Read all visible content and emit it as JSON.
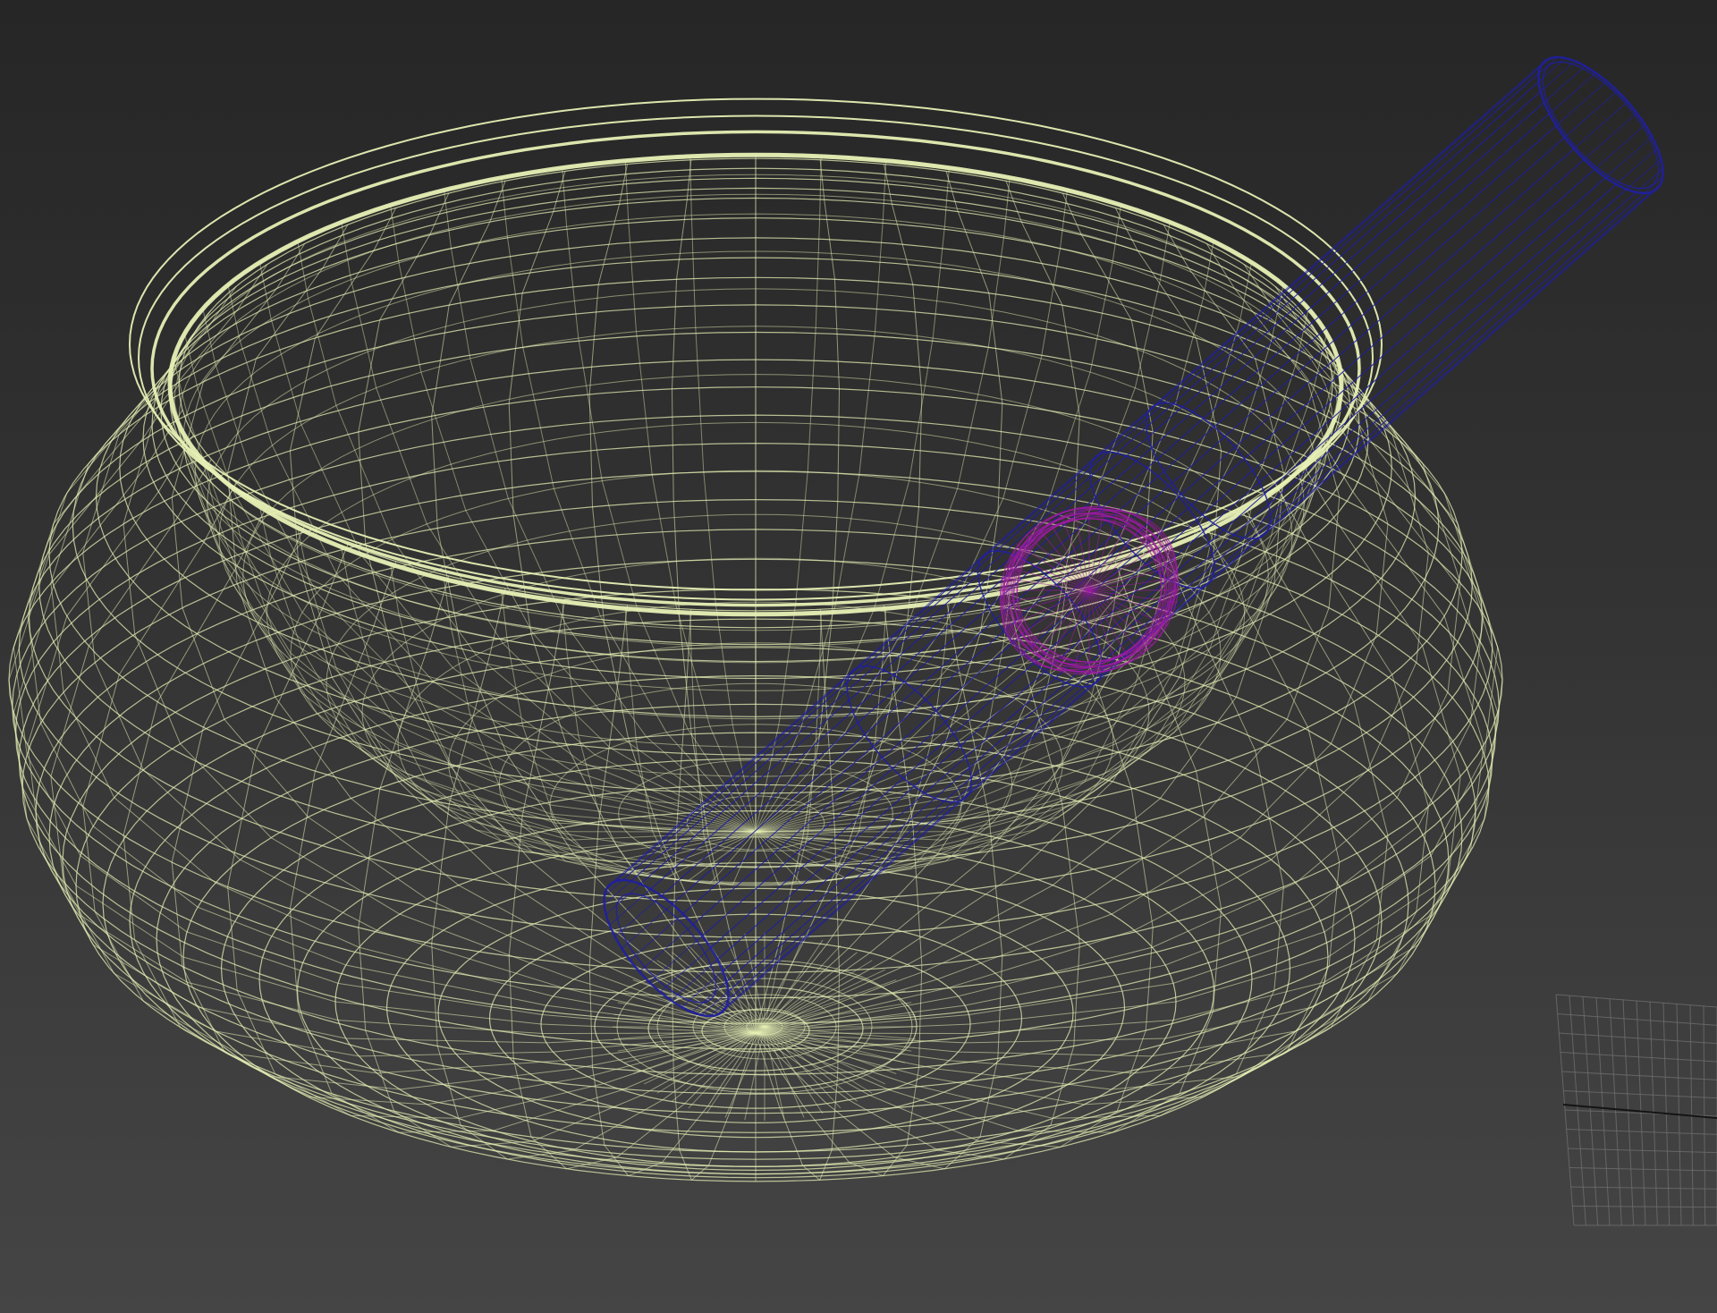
{
  "viewport": {
    "background_top": "#262626",
    "background_bottom": "#454545"
  },
  "objects": [
    {
      "name": "bowl",
      "kind": "singing-bowl wireframe mesh",
      "color": "#e6efb4",
      "selected": false
    },
    {
      "name": "striker-stick",
      "kind": "cylinder wireframe mesh",
      "color": "#1f1fa3",
      "selected": false
    },
    {
      "name": "striker-head",
      "kind": "torus / disc wireframe mesh",
      "color": "#a11aa6",
      "selected": false
    }
  ],
  "home_grid": {
    "color": "#6e6e6e",
    "axis_color": "#141414"
  }
}
